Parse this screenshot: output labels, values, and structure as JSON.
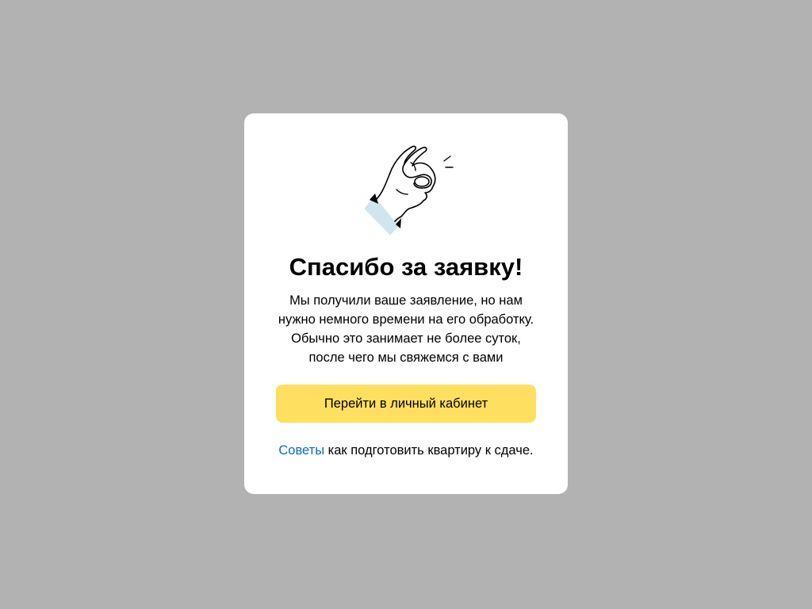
{
  "page": {
    "background_color": "#b2b2b2"
  },
  "modal": {
    "illustration_icon": "ok-hand-gesture-icon",
    "title": "Спасибо за заявку!",
    "body_lines": [
      "Мы получили ваше заявление, но нам",
      "нужно немного времени на его обработку.",
      "Обычно это занимает не более суток,",
      "после чего мы свяжемся с вами"
    ],
    "primary_button_label": "Перейти в личный кабинет",
    "primary_button_color": "#ffdf60",
    "tips_link_label": "Советы",
    "tips_link_color": "#0a6bc4",
    "tips_text": " как подготовить квартиру к сдаче."
  }
}
